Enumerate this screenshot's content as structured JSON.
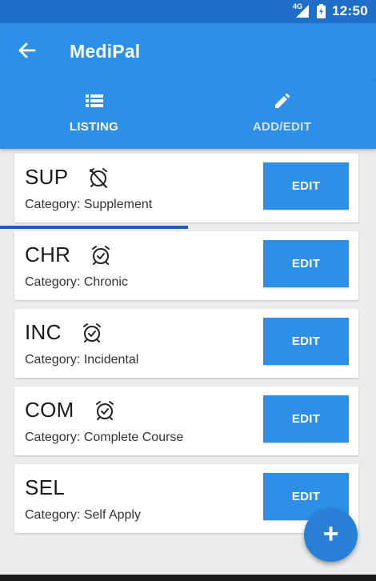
{
  "status_bar": {
    "network": "4G",
    "time": "12:50",
    "icons": [
      "signal-icon",
      "battery-icon"
    ]
  },
  "app_bar": {
    "title": "MediPal",
    "back_icon": "arrow-left-icon"
  },
  "tabs": [
    {
      "label": "LISTING",
      "icon": "list-icon",
      "active": true
    },
    {
      "label": "ADD/EDIT",
      "icon": "pencil-icon",
      "active": false
    }
  ],
  "items": [
    {
      "code": "SUP",
      "category": "Category: Supplement",
      "alarm": "off",
      "edit_label": "EDIT"
    },
    {
      "code": "CHR",
      "category": "Category: Chronic",
      "alarm": "on",
      "edit_label": "EDIT"
    },
    {
      "code": "INC",
      "category": "Category: Incidental",
      "alarm": "on",
      "edit_label": "EDIT"
    },
    {
      "code": "COM",
      "category": "Category: Complete Course",
      "alarm": "on",
      "edit_label": "EDIT"
    },
    {
      "code": "SEL",
      "category": "Category: Self Apply",
      "alarm": "none",
      "edit_label": "EDIT"
    }
  ],
  "fab": {
    "label": "+",
    "icon": "plus-icon"
  },
  "colors": {
    "primary": "#2d8fe8",
    "status_bar": "#1f6fc8",
    "background": "#ececec"
  }
}
